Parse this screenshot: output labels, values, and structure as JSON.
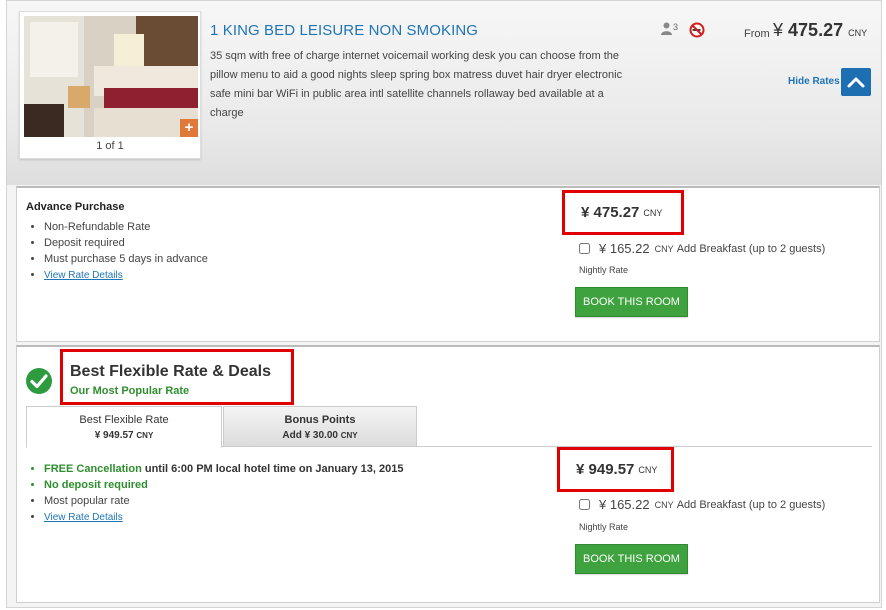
{
  "room": {
    "title": "1 KING BED LEISURE NON SMOKING",
    "description": "35 sqm with free of charge internet voicemail working desk you can choose from the pillow menu to aid a good nights sleep spring box matress duvet hair dryer electronic safe mini bar WiFi in public area intl satellite channels rollaway bed available at a charge",
    "photo_count": "1 of 1",
    "occupancy": "3",
    "from_label": "From",
    "from_currency_symbol": "¥",
    "from_price": "475.27",
    "currency": "CNY",
    "hide_rates_label": "Hide Rates"
  },
  "rates": [
    {
      "name": "Advance Purchase",
      "features": [
        "Non-Refundable Rate",
        "Deposit required",
        "Must purchase 5 days in advance"
      ],
      "details_link": "View Rate Details",
      "price_symbol": "¥",
      "price": "475.27",
      "currency": "CNY",
      "addon_price": "¥ 165.22",
      "addon_currency": "CNY",
      "addon_label": "Add Breakfast (up to 2 guests)",
      "nightly_label": "Nightly Rate",
      "book_label": "BOOK THIS ROOM"
    },
    {
      "name": "Best Flexible Rate & Deals",
      "subtitle": "Our Most Popular Rate",
      "tabs": [
        {
          "label": "Best Flexible Rate",
          "value": "¥ 949.57",
          "currency": "CNY"
        },
        {
          "label": "Bonus Points",
          "value": "Add  ¥ 30.00",
          "currency": "CNY"
        }
      ],
      "free_cancel_label": "FREE Cancellation",
      "free_cancel_rest": " until 6:00 PM local hotel time on January 13, 2015",
      "no_deposit": "No deposit required",
      "popular": "Most popular rate",
      "details_link": "View Rate Details",
      "price_symbol": "¥",
      "price": "949.57",
      "currency": "CNY",
      "addon_price": "¥ 165.22",
      "addon_currency": "CNY",
      "addon_label": "Add Breakfast (up to 2 guests)",
      "nightly_label": "Nightly Rate",
      "book_label": "BOOK THIS ROOM"
    }
  ],
  "colors": {
    "link": "#1f74b6",
    "book_button": "#3ea33e",
    "highlight_border": "#e00000",
    "green_text": "#2f8f2f"
  },
  "icons": [
    "person-icon",
    "no-smoking-icon",
    "chevron-up-icon",
    "plus-icon",
    "checkmark-circle-icon"
  ]
}
